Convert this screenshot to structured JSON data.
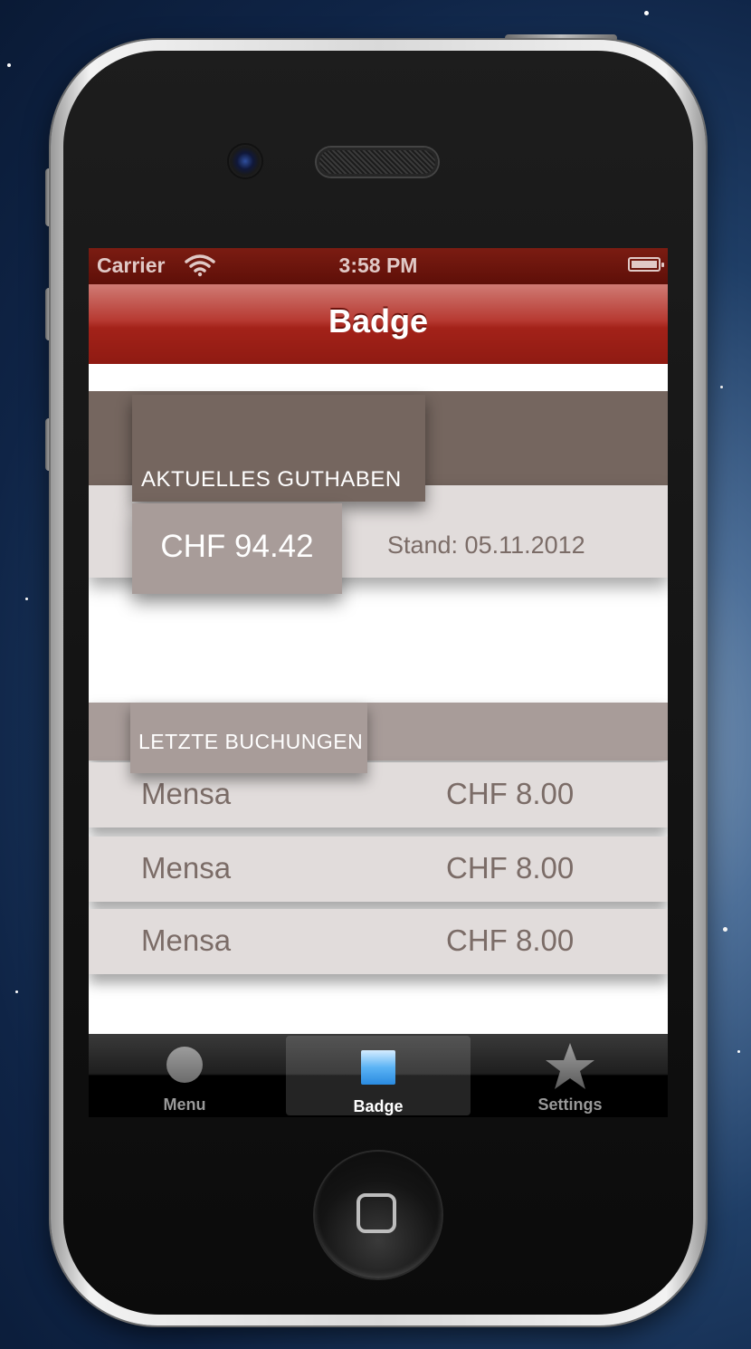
{
  "status_bar": {
    "carrier": "Carrier",
    "time": "3:58 PM"
  },
  "nav": {
    "title": "Badge"
  },
  "balance_section": {
    "header": "AKTUELLES GUTHABEN",
    "amount": "CHF 94.42",
    "stand": "Stand: 05.11.2012"
  },
  "bookings_section": {
    "header": "LETZTE BUCHUNGEN",
    "items": [
      {
        "name": "Mensa",
        "amount": "CHF 8.00"
      },
      {
        "name": "Mensa",
        "amount": "CHF 8.00"
      },
      {
        "name": "Mensa",
        "amount": "CHF 8.00"
      }
    ]
  },
  "tab_bar": {
    "tabs": [
      {
        "label": "Menu",
        "icon": "circle-icon"
      },
      {
        "label": "Badge",
        "icon": "badge-square-icon"
      },
      {
        "label": "Settings",
        "icon": "star-icon"
      }
    ],
    "selected": "Badge"
  },
  "colors": {
    "accent_red": "#a32219",
    "section_dark": "#75665f",
    "section_light": "#a89c99",
    "row_bg": "#e1dcdb",
    "text_brown": "#7b6c67"
  }
}
